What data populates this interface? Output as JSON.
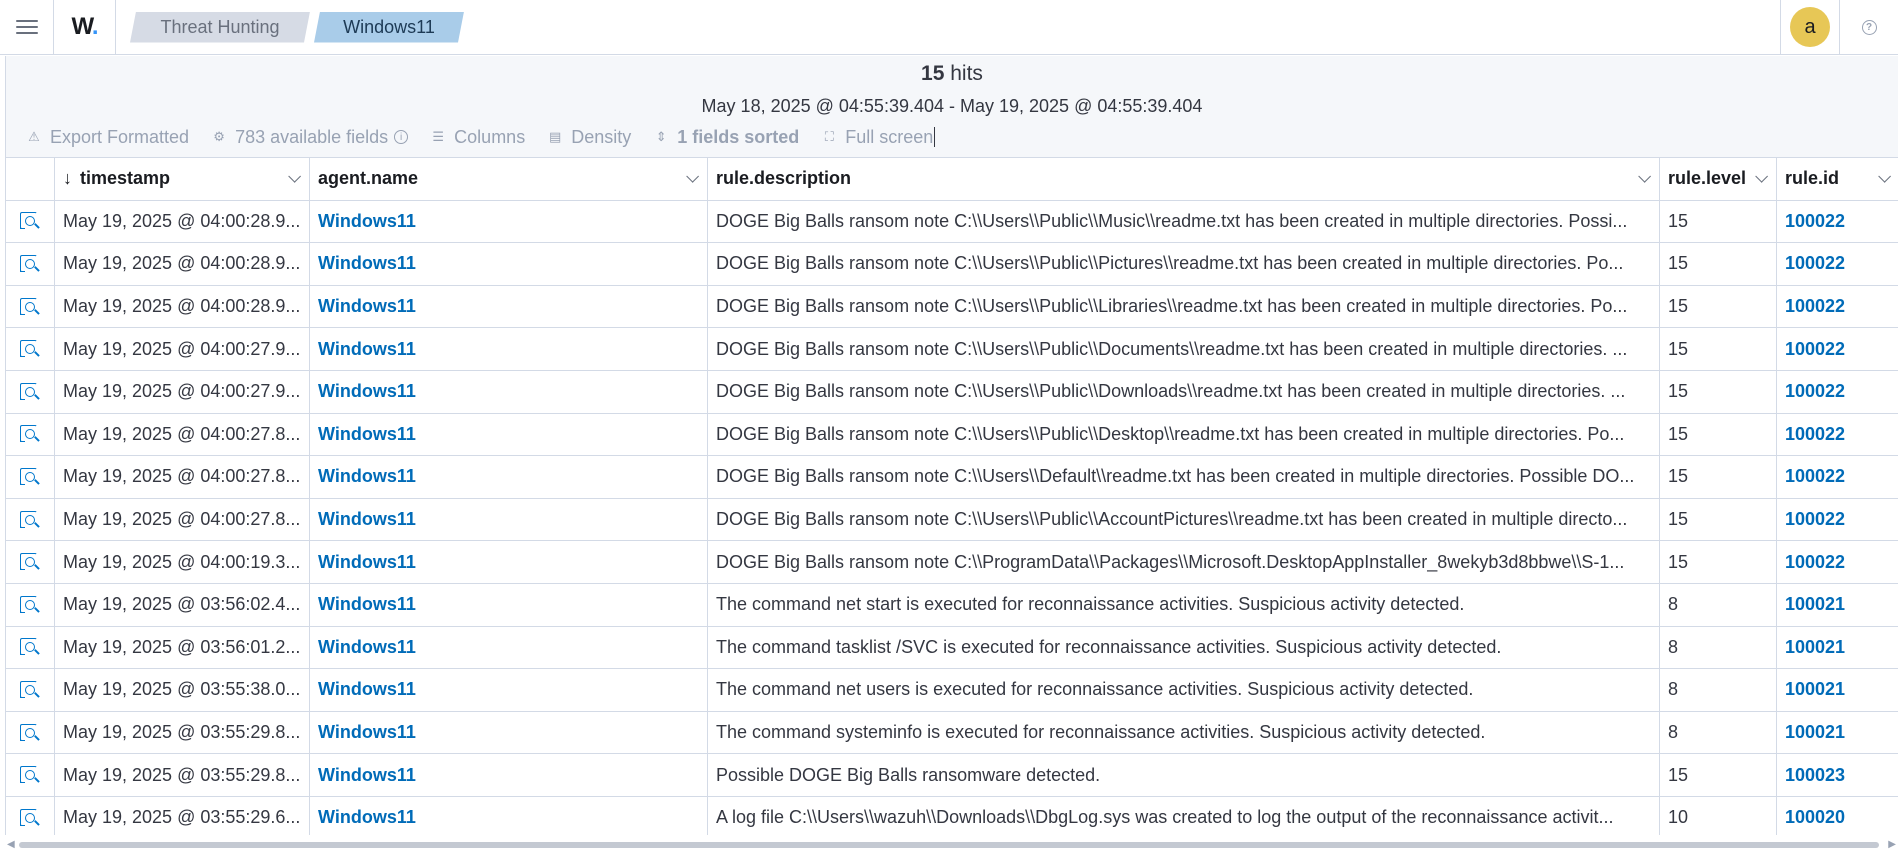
{
  "header": {
    "logo": "W",
    "breadcrumbs": [
      "Threat Hunting",
      "Windows11"
    ],
    "avatar_letter": "a",
    "help_glyph": "?"
  },
  "summary": {
    "hits_count": "15",
    "hits_label": "hits",
    "time_range": "May 18, 2025 @ 04:55:39.404 - May 19, 2025 @ 04:55:39.404"
  },
  "toolbar": {
    "export": "Export Formatted",
    "fields": "783 available fields",
    "columns": "Columns",
    "density": "Density",
    "sorted": "1 fields sorted",
    "fullscreen": "Full screen"
  },
  "table": {
    "columns": [
      "timestamp",
      "agent.name",
      "rule.description",
      "rule.level",
      "rule.id"
    ],
    "rows": [
      {
        "timestamp": "May 19, 2025 @ 04:00:28.9...",
        "agent": "Windows11",
        "description": "DOGE Big Balls ransom note C:\\\\Users\\\\Public\\\\Music\\\\readme.txt has been created in multiple directories. Possi...",
        "level": "15",
        "id": "100022"
      },
      {
        "timestamp": "May 19, 2025 @ 04:00:28.9...",
        "agent": "Windows11",
        "description": "DOGE Big Balls ransom note C:\\\\Users\\\\Public\\\\Pictures\\\\readme.txt has been created in multiple directories. Po...",
        "level": "15",
        "id": "100022"
      },
      {
        "timestamp": "May 19, 2025 @ 04:00:28.9...",
        "agent": "Windows11",
        "description": "DOGE Big Balls ransom note C:\\\\Users\\\\Public\\\\Libraries\\\\readme.txt has been created in multiple directories. Po...",
        "level": "15",
        "id": "100022"
      },
      {
        "timestamp": "May 19, 2025 @ 04:00:27.9...",
        "agent": "Windows11",
        "description": "DOGE Big Balls ransom note C:\\\\Users\\\\Public\\\\Documents\\\\readme.txt has been created in multiple directories. ...",
        "level": "15",
        "id": "100022"
      },
      {
        "timestamp": "May 19, 2025 @ 04:00:27.9...",
        "agent": "Windows11",
        "description": "DOGE Big Balls ransom note C:\\\\Users\\\\Public\\\\Downloads\\\\readme.txt has been created in multiple directories. ...",
        "level": "15",
        "id": "100022"
      },
      {
        "timestamp": "May 19, 2025 @ 04:00:27.8...",
        "agent": "Windows11",
        "description": "DOGE Big Balls ransom note C:\\\\Users\\\\Public\\\\Desktop\\\\readme.txt has been created in multiple directories. Po...",
        "level": "15",
        "id": "100022"
      },
      {
        "timestamp": "May 19, 2025 @ 04:00:27.8...",
        "agent": "Windows11",
        "description": "DOGE Big Balls ransom note C:\\\\Users\\\\Default\\\\readme.txt has been created in multiple directories. Possible DO...",
        "level": "15",
        "id": "100022"
      },
      {
        "timestamp": "May 19, 2025 @ 04:00:27.8...",
        "agent": "Windows11",
        "description": "DOGE Big Balls ransom note C:\\\\Users\\\\Public\\\\AccountPictures\\\\readme.txt has been created in multiple directo...",
        "level": "15",
        "id": "100022"
      },
      {
        "timestamp": "May 19, 2025 @ 04:00:19.3...",
        "agent": "Windows11",
        "description": "DOGE Big Balls ransom note C:\\\\ProgramData\\\\Packages\\\\Microsoft.DesktopAppInstaller_8wekyb3d8bbwe\\\\S-1...",
        "level": "15",
        "id": "100022"
      },
      {
        "timestamp": "May 19, 2025 @ 03:56:02.4...",
        "agent": "Windows11",
        "description": "The command net start is executed for reconnaissance activities. Suspicious activity detected.",
        "level": "8",
        "id": "100021"
      },
      {
        "timestamp": "May 19, 2025 @ 03:56:01.2...",
        "agent": "Windows11",
        "description": "The command tasklist /SVC is executed for reconnaissance activities. Suspicious activity detected.",
        "level": "8",
        "id": "100021"
      },
      {
        "timestamp": "May 19, 2025 @ 03:55:38.0...",
        "agent": "Windows11",
        "description": "The command net users is executed for reconnaissance activities. Suspicious activity detected.",
        "level": "8",
        "id": "100021"
      },
      {
        "timestamp": "May 19, 2025 @ 03:55:29.8...",
        "agent": "Windows11",
        "description": "The command systeminfo is executed for reconnaissance activities. Suspicious activity detected.",
        "level": "8",
        "id": "100021"
      },
      {
        "timestamp": "May 19, 2025 @ 03:55:29.8...",
        "agent": "Windows11",
        "description": "Possible DOGE Big Balls ransomware detected.",
        "level": "15",
        "id": "100023"
      },
      {
        "timestamp": "May 19, 2025 @ 03:55:29.6...",
        "agent": "Windows11",
        "description": "A log file C:\\\\Users\\\\wazuh\\\\Downloads\\\\DbgLog.sys was created to log the output of the reconnaissance activit...",
        "level": "10",
        "id": "100020"
      }
    ]
  },
  "colors": {
    "link": "#006bb8",
    "breadcrumb_active": "#a9cce9",
    "breadcrumb_inactive": "#d6dbe5",
    "avatar": "#e7c756"
  }
}
